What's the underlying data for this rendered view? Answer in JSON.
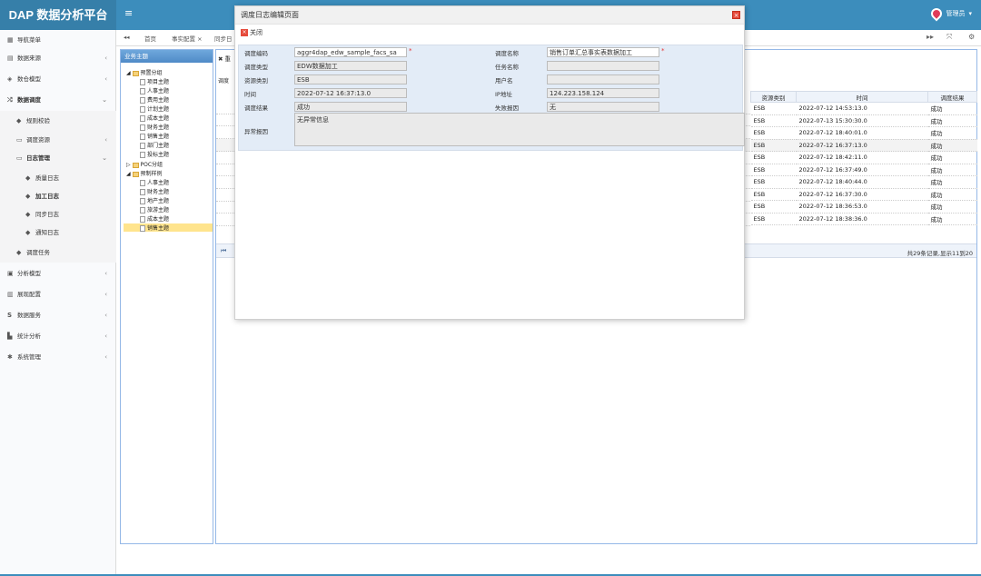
{
  "app": {
    "title": "DAP 数据分析平台",
    "user": "管理员"
  },
  "sidebar": {
    "nav_label": "导航菜单",
    "items": [
      {
        "label": "数据来源"
      },
      {
        "label": "数仓模型"
      },
      {
        "label": "数据调度"
      },
      {
        "label": "规则校验"
      },
      {
        "label": "调度资源"
      },
      {
        "label": "日志管理"
      },
      {
        "label": "质量日志"
      },
      {
        "label": "加工日志"
      },
      {
        "label": "同步日志"
      },
      {
        "label": "通知日志"
      },
      {
        "label": "调度任务"
      },
      {
        "label": "分析模型"
      },
      {
        "label": "展现配置"
      },
      {
        "label": "数据服务"
      },
      {
        "label": "统计分析"
      },
      {
        "label": "系统管理"
      }
    ]
  },
  "tabs": [
    {
      "label": "首页"
    },
    {
      "label": "事实配置 ×"
    },
    {
      "label": "同步日"
    }
  ],
  "tree": {
    "title": "业务主题",
    "nodes": [
      {
        "label": "预置分组"
      },
      {
        "label": "项目主题"
      },
      {
        "label": "人事主题"
      },
      {
        "label": "费用主题"
      },
      {
        "label": "计划主题"
      },
      {
        "label": "成本主题"
      },
      {
        "label": "财务主题"
      },
      {
        "label": "销售主题"
      },
      {
        "label": "部门主题"
      },
      {
        "label": "投标主题"
      },
      {
        "label": "POC分组"
      },
      {
        "label": "预制样例"
      },
      {
        "label": "人事主题"
      },
      {
        "label": "财务主题"
      },
      {
        "label": "地产主题"
      },
      {
        "label": "旅游主题"
      },
      {
        "label": "成本主题"
      },
      {
        "label": "销售主题"
      }
    ]
  },
  "grid": {
    "tab_label": "重",
    "toolbar_label": "调度",
    "columns": [
      "资源类别",
      "时间",
      "调度结果"
    ],
    "rows": [
      {
        "type": "ESB",
        "time": "2022-07-12 14:53:13.0",
        "result": "成功"
      },
      {
        "type": "ESB",
        "time": "2022-07-13 15:30:30.0",
        "result": "成功"
      },
      {
        "type": "ESB",
        "time": "2022-07-12 18:40:01.0",
        "result": "成功"
      },
      {
        "type": "ESB",
        "time": "2022-07-12 16:37:13.0",
        "result": "成功"
      },
      {
        "type": "ESB",
        "time": "2022-07-12 18:42:11.0",
        "result": "成功"
      },
      {
        "type": "ESB",
        "time": "2022-07-12 16:37:49.0",
        "result": "成功"
      },
      {
        "type": "ESB",
        "time": "2022-07-12 18:40:44.0",
        "result": "成功"
      },
      {
        "type": "ESB",
        "time": "2022-07-12 16:37:30.0",
        "result": "成功"
      },
      {
        "type": "ESB",
        "time": "2022-07-12 18:36:53.0",
        "result": "成功"
      },
      {
        "type": "ESB",
        "time": "2022-07-12 18:38:36.0",
        "result": "成功"
      }
    ],
    "pager_text": "共29条记录,显示11到20"
  },
  "modal": {
    "title": "调度日志编辑页面",
    "close_label": "关闭",
    "fields": {
      "code_label": "调度编码",
      "code_value": "aggr4dap_edw_sample_facs_sa",
      "name_label": "调度名称",
      "name_value": "销售订单汇总事实表数据加工",
      "type_label": "调度类型",
      "type_value": "EDW数据加工",
      "task_label": "任务名称",
      "task_value": "",
      "res_label": "资源类别",
      "res_value": "ESB",
      "user_label": "用户名",
      "user_value": "",
      "time_label": "时间",
      "time_value": "2022-07-12 16:37:13.0",
      "ip_label": "IP地址",
      "ip_value": "124.223.158.124",
      "result_label": "调度结果",
      "result_value": "成功",
      "fail_label": "失败报因",
      "fail_value": "无",
      "err_label": "异常报因",
      "err_value": "无异常信息"
    }
  }
}
